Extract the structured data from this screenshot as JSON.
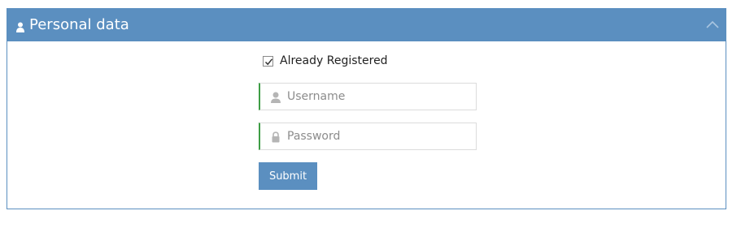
{
  "panel": {
    "title": "Personal data",
    "header_icon": "user-icon",
    "toggle_icon": "chevron-up-icon",
    "accent_color": "#5b8fc0"
  },
  "form": {
    "already_registered": {
      "label": "Already Registered",
      "checked": true
    },
    "username": {
      "placeholder": "Username",
      "value": "",
      "icon": "user-icon"
    },
    "password": {
      "placeholder": "Password",
      "value": "",
      "icon": "lock-icon"
    },
    "submit_label": "Submit",
    "valid_color": "#3e9d45"
  }
}
